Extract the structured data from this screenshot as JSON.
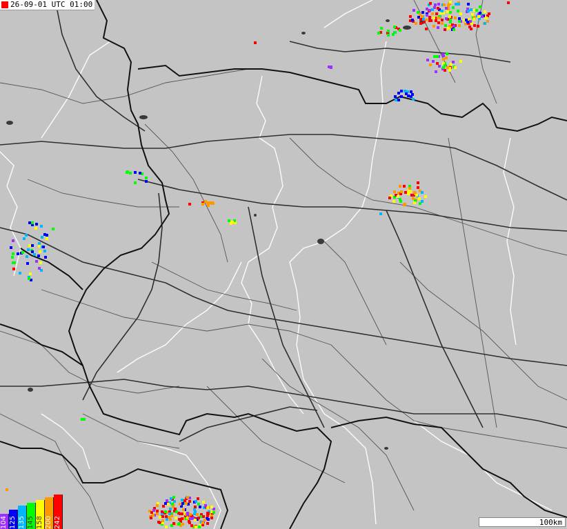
{
  "timestamp": {
    "text": "26-09-01 UTC 01:00",
    "marker_color": "#ff0000"
  },
  "legend": {
    "items": [
      {
        "label": "104",
        "color": "#9b30ff"
      },
      {
        "label": "125",
        "color": "#0000ff"
      },
      {
        "label": "135",
        "color": "#00b7ff"
      },
      {
        "label": "145",
        "color": "#00ff00"
      },
      {
        "label": "158",
        "color": "#ffff00"
      },
      {
        "label": "200",
        "color": "#ff9900"
      },
      {
        "label": "242",
        "color": "#ff0000"
      }
    ]
  },
  "scale": {
    "label": "100km"
  },
  "map_style": {
    "land_color": "#c4c4c4",
    "road_color": "#333333",
    "border_color": "#111111",
    "river_color": "#ffffff",
    "lake_color": "#444444"
  }
}
